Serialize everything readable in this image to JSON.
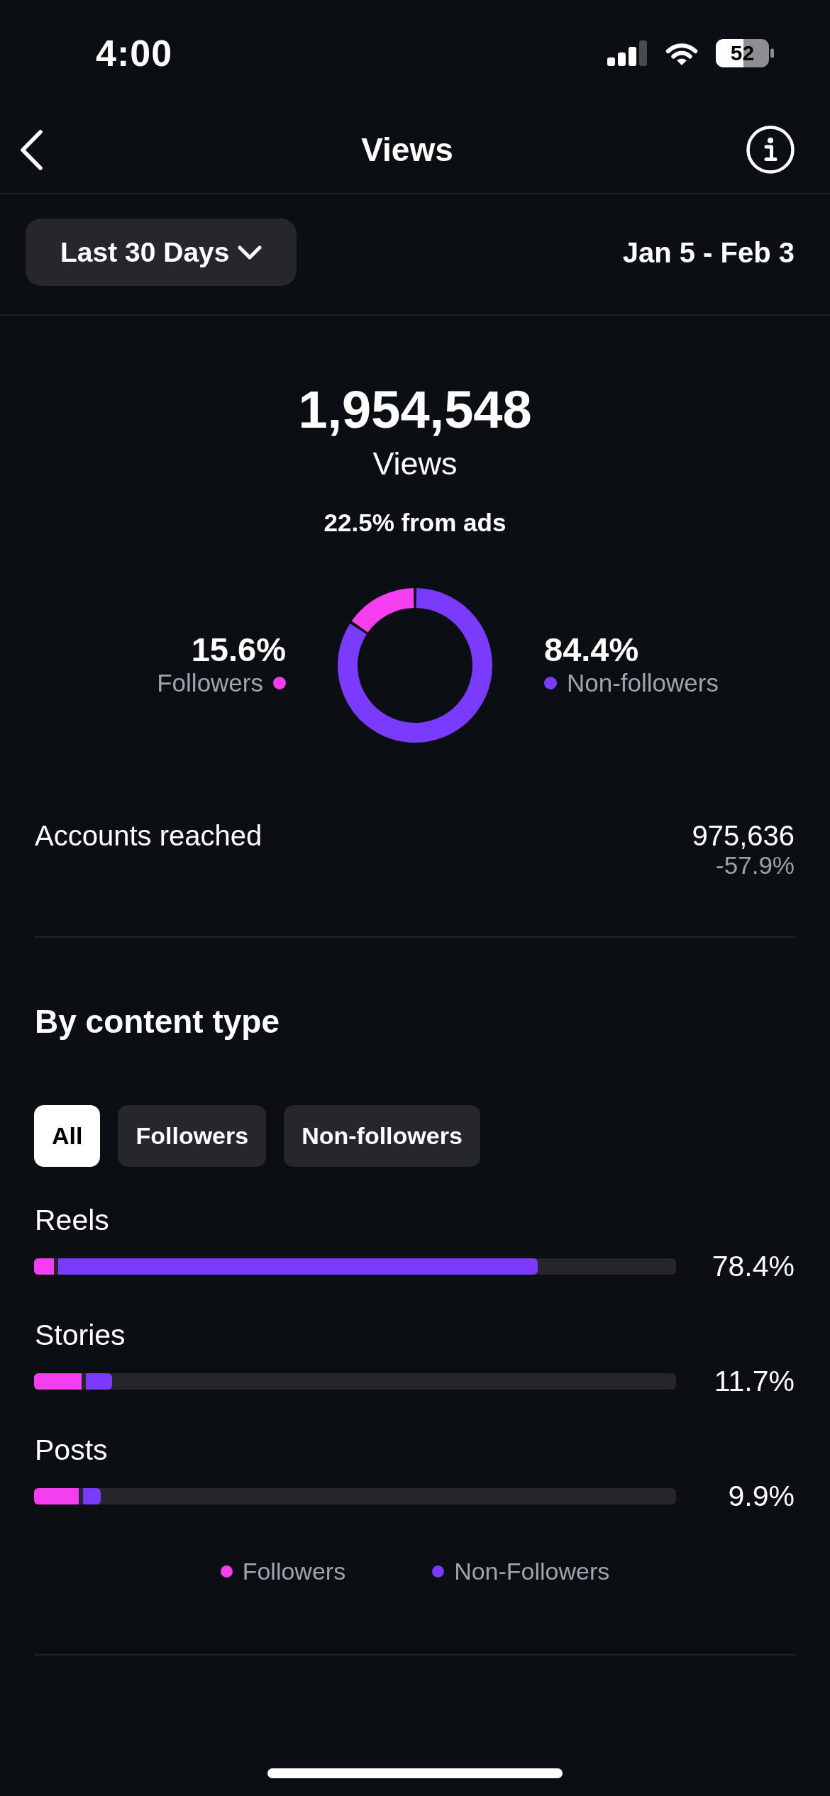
{
  "status_bar": {
    "time": "4:00",
    "battery": "52"
  },
  "header": {
    "title": "Views"
  },
  "range": {
    "dropdown": "Last 30 Days",
    "dates": "Jan 5 - Feb 3"
  },
  "summary": {
    "total": "1,954,548",
    "label": "Views",
    "ads_note": "22.5% from ads"
  },
  "audience": {
    "chart_data": {
      "type": "donut",
      "categories": [
        "Followers",
        "Non-followers"
      ],
      "values": [
        15.6,
        84.4
      ],
      "value_labels": [
        "15.6%",
        "84.4%"
      ],
      "colors": [
        "#f43ef0",
        "#7b3bfe"
      ]
    }
  },
  "accounts_reached": {
    "label": "Accounts reached",
    "value": "975,636",
    "change": "-57.9%"
  },
  "content_type": {
    "title": "By content type",
    "filters": [
      {
        "label": "All",
        "selected": true
      },
      {
        "label": "Followers",
        "selected": false
      },
      {
        "label": "Non-followers",
        "selected": false
      }
    ],
    "rows": [
      {
        "label": "Reels",
        "value": "78.4%",
        "level": 0.784,
        "color": "#7b3bfe",
        "followers": {
          "level": 0.031,
          "color": "#f43ef0"
        }
      },
      {
        "label": "Stories",
        "value": "11.7%",
        "level": 0.122,
        "color": "#7b3bfe",
        "followers": {
          "level": 0.074,
          "color": "#f43ef0"
        }
      },
      {
        "label": "Posts",
        "value": "9.9%",
        "level": 0.104,
        "color": "#7b3bfe",
        "followers": {
          "level": 0.07,
          "color": "#f43ef0"
        }
      }
    ],
    "legend": [
      {
        "label": "Followers",
        "color": "#f43ef0"
      },
      {
        "label": "Non-Followers",
        "color": "#7b3bfe"
      }
    ]
  }
}
